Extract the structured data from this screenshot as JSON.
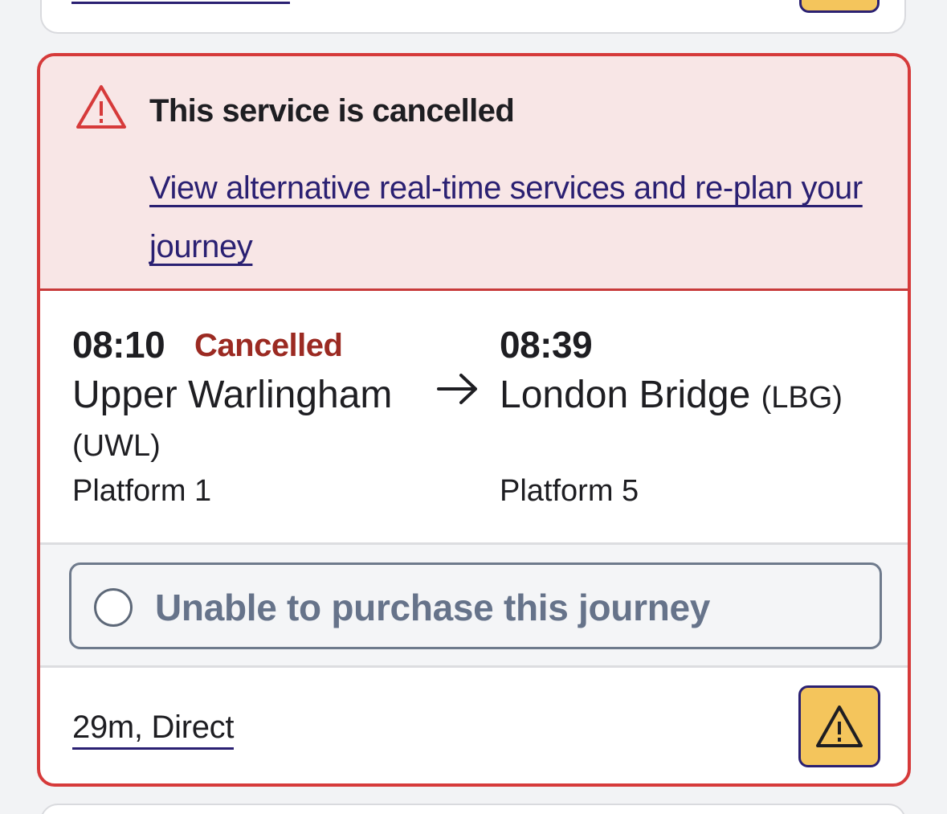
{
  "alert": {
    "title": "This service is cancelled",
    "link_text": "View alternative real-time services and re-plan your journey"
  },
  "journey": {
    "departure": {
      "time": "08:10",
      "status": "Cancelled",
      "station": "Upper Warlingham",
      "code": "(UWL)",
      "platform": "Platform 1"
    },
    "arrival": {
      "time": "08:39",
      "station": "London Bridge",
      "code": "(LBG)",
      "platform": "Platform 5"
    }
  },
  "purchase": {
    "label": "Unable to purchase this journey"
  },
  "footer": {
    "duration": "29m, Direct"
  },
  "colors": {
    "alert_red": "#d63a3a",
    "alert_bg": "#f8e6e6",
    "cancelled_text": "#9b2a22",
    "link": "#2a2072",
    "warning_yellow": "#f4c55c",
    "disabled_text": "#66738a"
  },
  "icons": [
    "warning-triangle-icon",
    "arrow-right-icon",
    "radio-empty-icon",
    "warning-icon"
  ]
}
